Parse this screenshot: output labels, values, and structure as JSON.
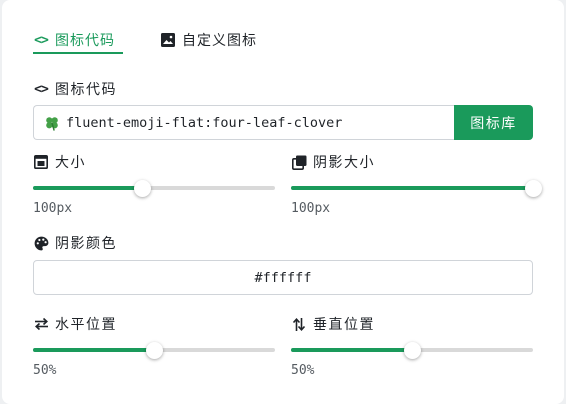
{
  "tabs": {
    "icon_code": "图标代码",
    "custom_icon": "自定义图标",
    "active": "icon_code",
    "active_color": "#1a9a5b"
  },
  "icon_code": {
    "label": "图标代码",
    "value": "fluent-emoji-flat:four-leaf-clover",
    "prefix_icon": "four-leaf-clover-icon",
    "library_button": "图标库"
  },
  "size": {
    "label": "大小",
    "icon": "image-size-icon",
    "value_text": "100px",
    "slider_fraction": 0.45
  },
  "shadow_size": {
    "label": "阴影大小",
    "icon": "copy-icon",
    "value_text": "100px",
    "slider_fraction": 1.0
  },
  "shadow_color": {
    "label": "阴影颜色",
    "icon": "palette-icon",
    "value": "#ffffff"
  },
  "horizontal": {
    "label": "水平位置",
    "icon": "swap-horizontal-icon",
    "value_text": "50%",
    "slider_fraction": 0.5
  },
  "vertical": {
    "label": "垂直位置",
    "icon": "swap-vertical-icon",
    "value_text": "50%",
    "slider_fraction": 0.5
  },
  "colors": {
    "accent": "#1a9a5b",
    "track": "#d9d9d9"
  }
}
